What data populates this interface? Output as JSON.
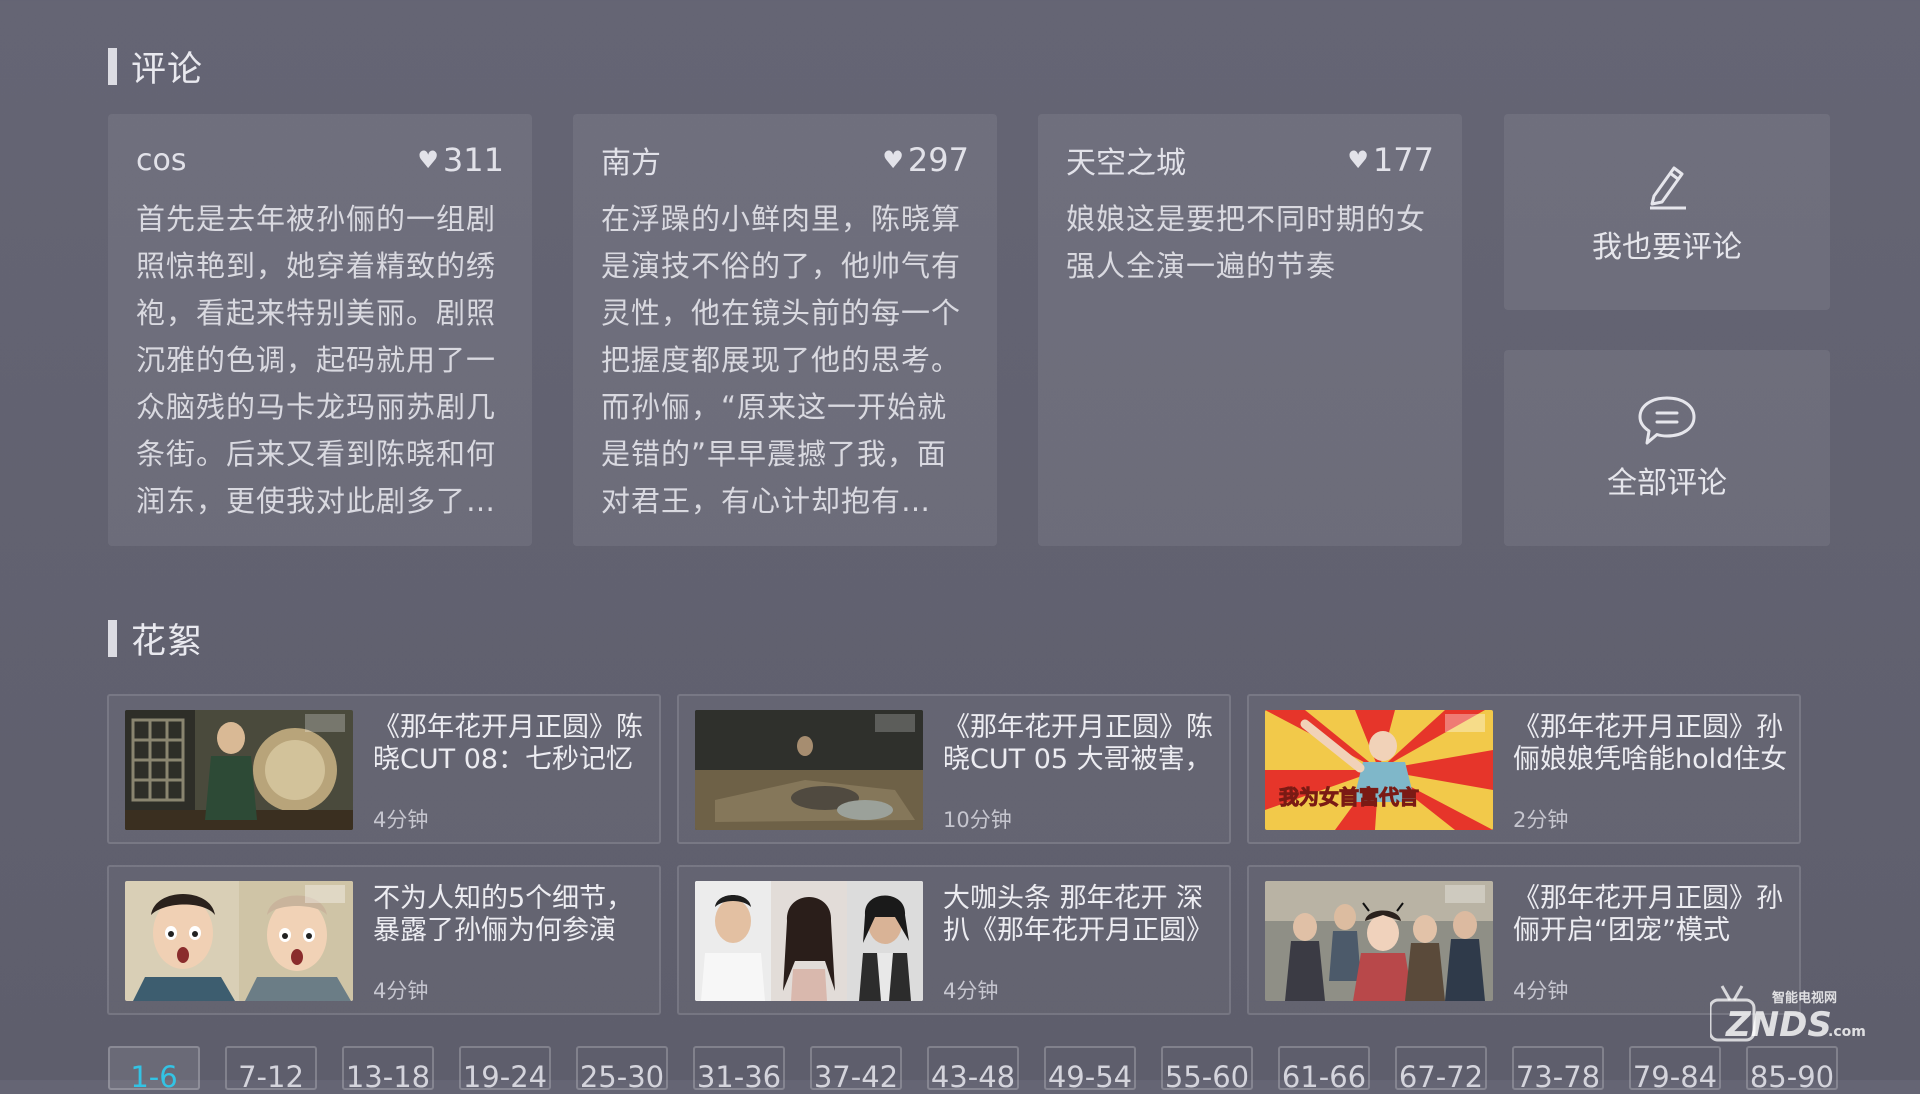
{
  "comments_section": {
    "title": "评论",
    "comments": [
      {
        "user": "cos",
        "likes": "311",
        "text": "首先是去年被孙俪的一组剧照惊艳到，她穿着精致的绣袍，看起来特别美丽。剧照沉雅的色调，起码就用了一众脑残的马卡龙玛丽苏剧几条街。后来又看到陈晓和何润东，更使我对此剧多了…"
      },
      {
        "user": "南方",
        "likes": "297",
        "text": "在浮躁的小鲜肉里，陈晓算是演技不俗的了，他帅气有灵性，他在镜头前的每一个把握度都展现了他的思考。而孙俪，“原来这一开始就是错的”早早震撼了我，面对君王，有心计却抱有…"
      },
      {
        "user": "天空之城",
        "likes": "177",
        "text": "娘娘这是要把不同时期的女强人全演一遍的节奏"
      }
    ],
    "actions": {
      "write_label": "我也要评论",
      "all_label": "全部评论"
    }
  },
  "clips_section": {
    "title": "花絮",
    "videos": [
      {
        "title": "《那年花开月正圆》陈晓CUT 08：七秒记忆",
        "duration": "4分钟"
      },
      {
        "title": "《那年花开月正圆》陈晓CUT 05 大哥被害，",
        "duration": "10分钟"
      },
      {
        "title": "《那年花开月正圆》孙俪娘娘凭啥能hold住女",
        "duration": "2分钟",
        "thumb_text": "我为女首富代言"
      },
      {
        "title": "不为人知的5个细节，暴露了孙俪为何参演",
        "duration": "4分钟"
      },
      {
        "title": "大咖头条 那年花开 深扒《那年花开月正圆》",
        "duration": "4分钟"
      },
      {
        "title": "《那年花开月正圆》孙俪开启“团宠”模式",
        "duration": "4分钟"
      }
    ]
  },
  "pager": {
    "active_index": 0,
    "pages": [
      "1-6",
      "7-12",
      "13-18",
      "19-24",
      "25-30",
      "31-36",
      "37-42",
      "43-48",
      "49-54",
      "55-60",
      "61-66",
      "67-72",
      "73-78",
      "79-84",
      "85-90"
    ]
  },
  "watermark": {
    "top_text": "智能电视网",
    "brand": "ZNDS",
    "suffix": ".com"
  },
  "colors": {
    "background": "#636371",
    "active_page": "#33c3e4",
    "card": "rgba(255,255,255,0.075)"
  }
}
